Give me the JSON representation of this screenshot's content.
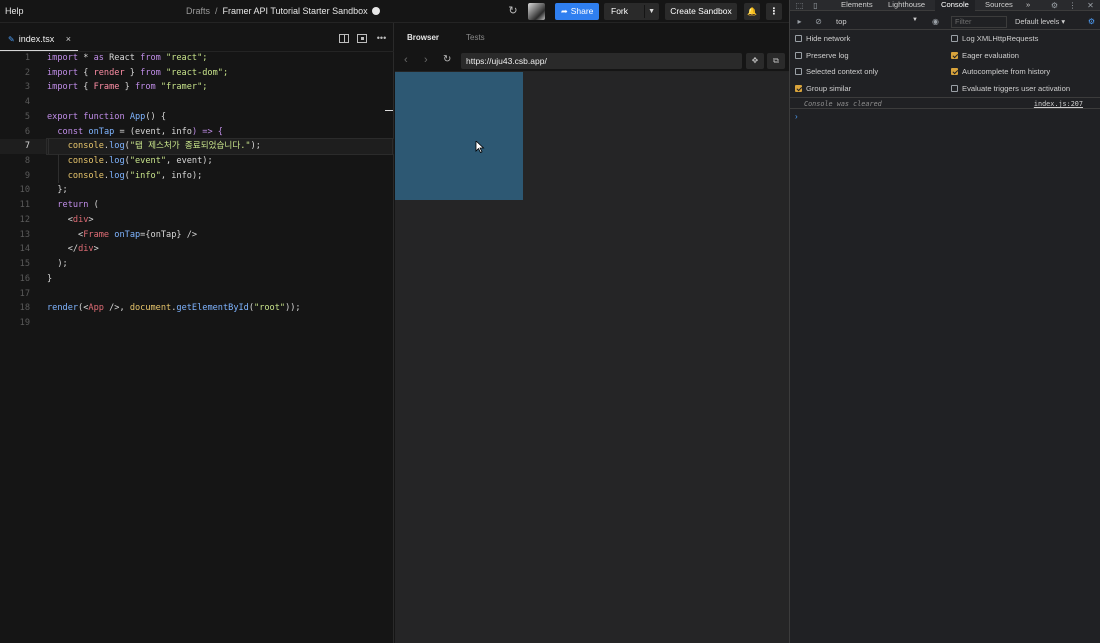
{
  "topbar": {
    "help": "Help",
    "breadcrumb_root": "Drafts",
    "breadcrumb_sep": "/",
    "sandbox_title": "Framer API Tutorial Starter Sandbox",
    "share_label": "Share",
    "fork_label": "Fork",
    "create_label": "Create Sandbox",
    "icons": [
      "refresh-icon",
      "globe-icon",
      "share-arrow-icon",
      "chevron-down-icon",
      "bell-icon",
      "more-vertical-icon"
    ]
  },
  "editor": {
    "tab_label": "index.tsx",
    "tab_close": "×",
    "lines": [
      {
        "n": "1"
      },
      {
        "n": "2"
      },
      {
        "n": "3"
      },
      {
        "n": "4"
      },
      {
        "n": "5"
      },
      {
        "n": "6"
      },
      {
        "n": "7"
      },
      {
        "n": "8"
      },
      {
        "n": "9"
      },
      {
        "n": "10"
      },
      {
        "n": "11"
      },
      {
        "n": "12"
      },
      {
        "n": "13"
      },
      {
        "n": "14"
      },
      {
        "n": "15"
      },
      {
        "n": "16"
      },
      {
        "n": "17"
      },
      {
        "n": "18"
      },
      {
        "n": "19"
      }
    ],
    "active_line": 7,
    "code": {
      "l1": [
        "import",
        " * ",
        "as",
        " React ",
        "from",
        " \"react\";"
      ],
      "l2": [
        "import",
        " { ",
        "render",
        " } ",
        "from",
        " \"react-dom\";"
      ],
      "l3": [
        "import",
        " { ",
        "Frame",
        " } ",
        "from",
        " \"framer\";"
      ],
      "l5": [
        "export",
        " ",
        "function",
        " ",
        "App",
        "() {"
      ],
      "l6": [
        "const",
        " ",
        "onTap",
        " = (",
        "event",
        ", ",
        "info",
        ") => {"
      ],
      "l7": [
        "console",
        ".",
        "log",
        "(",
        "\"탭 제스처가 종료되었습니다.\"",
        ");"
      ],
      "l8": [
        "console",
        ".",
        "log",
        "(",
        "\"event\"",
        ", ",
        "event",
        ");"
      ],
      "l9": [
        "console",
        ".",
        "log",
        "(",
        "\"info\"",
        ", ",
        "info",
        ");"
      ],
      "l10": "};",
      "l11": [
        "return",
        " ("
      ],
      "l12": [
        "<",
        "div",
        ">"
      ],
      "l13": [
        "<",
        "Frame",
        " ",
        "onTap",
        "={",
        "onTap",
        "} />"
      ],
      "l14": [
        "</",
        "div",
        ">"
      ],
      "l15": ");",
      "l16": "}",
      "l18": [
        "render",
        "(<",
        "App",
        " />, ",
        "document",
        ".",
        "getElementById",
        "(",
        "\"root\"",
        "));"
      ]
    }
  },
  "browser": {
    "tab_browser": "Browser",
    "tab_tests": "Tests",
    "url": "https://uju43.csb.app/",
    "frame_color": "#2d5873"
  },
  "devtools": {
    "tabs": [
      "Elements",
      "Lighthouse",
      "Console",
      "Sources",
      "»"
    ],
    "active_tab": "Console",
    "context": "top",
    "filter_placeholder": "Filter",
    "levels": "Default levels ▾",
    "options": [
      {
        "label": "Hide network",
        "checked": false
      },
      {
        "label": "Log XMLHttpRequests",
        "checked": false
      },
      {
        "label": "Preserve log",
        "checked": false
      },
      {
        "label": "Eager evaluation",
        "checked": true
      },
      {
        "label": "Selected context only",
        "checked": false
      },
      {
        "label": "Autocomplete from history",
        "checked": true
      },
      {
        "label": "Group similar",
        "checked": true
      },
      {
        "label": "Evaluate triggers user activation",
        "checked": false
      }
    ],
    "console_cleared": "Console was cleared",
    "console_source": "index.js:207",
    "prompt": "›"
  }
}
